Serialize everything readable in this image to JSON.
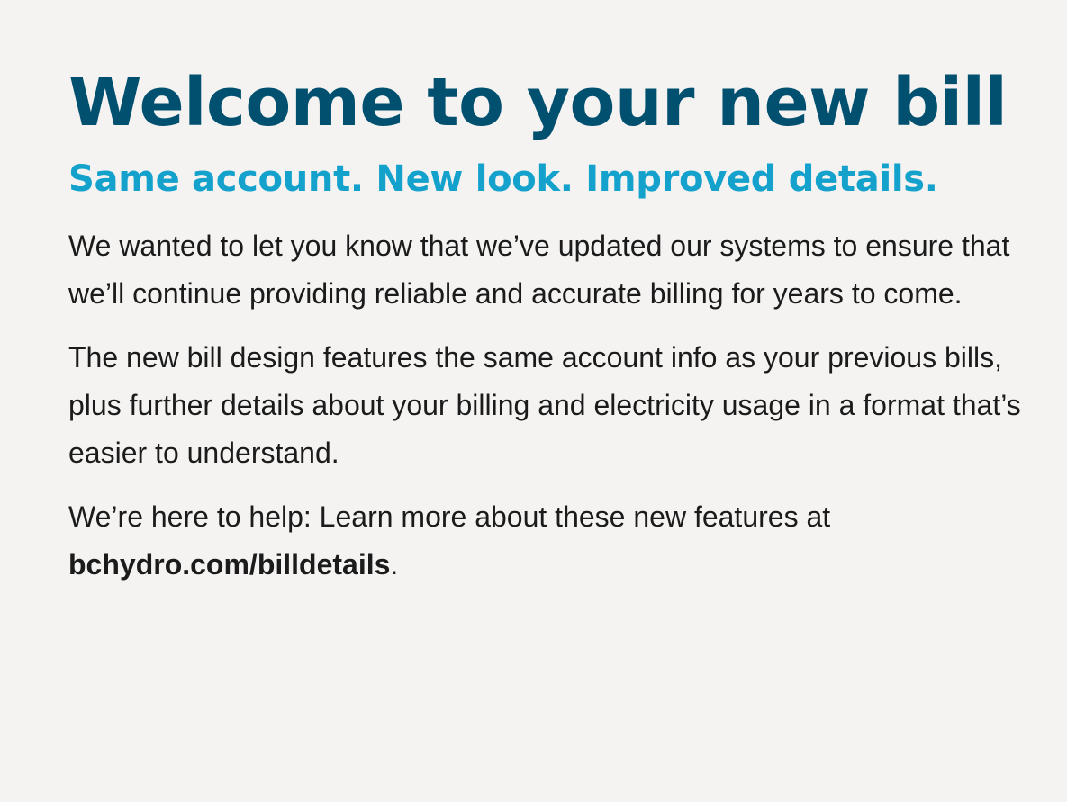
{
  "heading": {
    "title": "Welcome to your new bill",
    "subtitle": "Same account. New look. Improved details."
  },
  "body": {
    "paragraph_1": "We wanted to let you know that we’ve updated our systems to ensure that we’ll continue providing reliable and accurate billing for years to come.",
    "paragraph_2": "The new bill design features the same account info as your previous bills, plus further details about your billing and electricity usage in a format that’s easier to understand.",
    "paragraph_3_intro": "We’re here to help: Learn more about these new features at ",
    "paragraph_3_link": "bchydro.com/billdetails",
    "paragraph_3_end": "."
  },
  "colors": {
    "background": "#f4f3f2",
    "title": "#01506f",
    "subtitle": "#14a2cc",
    "body_text": "#1b1b1b"
  }
}
